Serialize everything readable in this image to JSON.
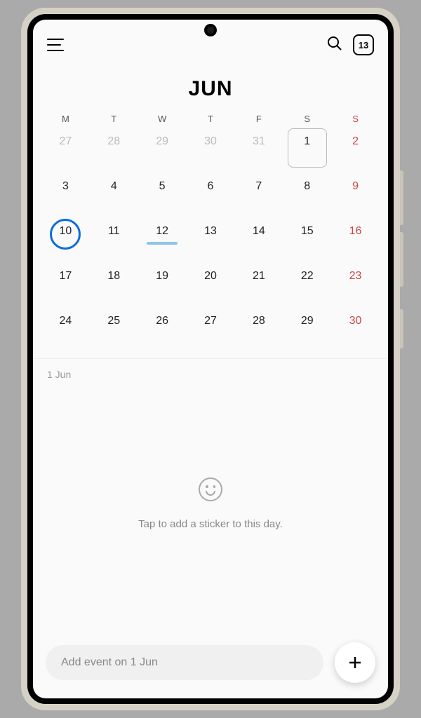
{
  "header": {
    "today_badge": "13"
  },
  "calendar": {
    "month_title": "JUN",
    "weekday_labels": [
      "M",
      "T",
      "W",
      "T",
      "F",
      "S",
      "S"
    ],
    "cells": [
      {
        "n": "27",
        "cls": "prev"
      },
      {
        "n": "28",
        "cls": "prev"
      },
      {
        "n": "29",
        "cls": "prev"
      },
      {
        "n": "30",
        "cls": "prev"
      },
      {
        "n": "31",
        "cls": "prev"
      },
      {
        "n": "1",
        "cls": "selected"
      },
      {
        "n": "2",
        "cls": "sun"
      },
      {
        "n": "3"
      },
      {
        "n": "4"
      },
      {
        "n": "5"
      },
      {
        "n": "6"
      },
      {
        "n": "7"
      },
      {
        "n": "8"
      },
      {
        "n": "9",
        "cls": "sun"
      },
      {
        "n": "10",
        "cls": "today"
      },
      {
        "n": "11"
      },
      {
        "n": "12",
        "cls": "event"
      },
      {
        "n": "13"
      },
      {
        "n": "14"
      },
      {
        "n": "15"
      },
      {
        "n": "16",
        "cls": "sun"
      },
      {
        "n": "17"
      },
      {
        "n": "18"
      },
      {
        "n": "19"
      },
      {
        "n": "20"
      },
      {
        "n": "21"
      },
      {
        "n": "22"
      },
      {
        "n": "23",
        "cls": "sun"
      },
      {
        "n": "24"
      },
      {
        "n": "25"
      },
      {
        "n": "26"
      },
      {
        "n": "27"
      },
      {
        "n": "28"
      },
      {
        "n": "29"
      },
      {
        "n": "30",
        "cls": "sun"
      }
    ]
  },
  "detail": {
    "date_label": "1 Jun",
    "sticker_prompt": "Tap to add a sticker to this day."
  },
  "bottom": {
    "event_input_placeholder": "Add event on 1 Jun"
  }
}
